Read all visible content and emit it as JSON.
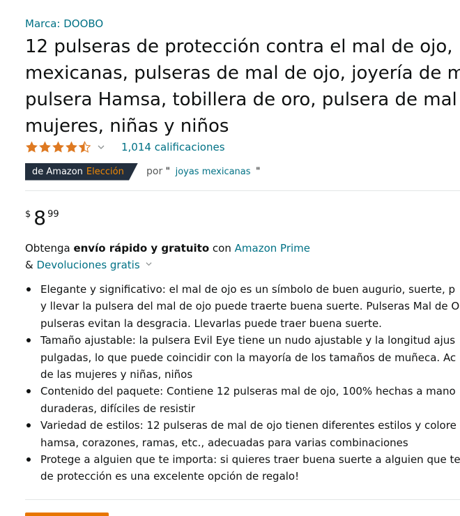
{
  "brand": {
    "text": "Marca: DOOBO"
  },
  "title": {
    "lines": [
      "12 pulseras de protección contra el mal de ojo,",
      "mexicanas, pulseras de mal de ojo, joyería de m",
      "pulsera Hamsa, tobillera de oro, pulsera de mal",
      "mujeres, niñas y niños"
    ]
  },
  "rating": {
    "stars_value": 4.5,
    "star_color": "#de7921",
    "count_text": "1,014 calificaciones"
  },
  "choice": {
    "badge_white": "de Amazon",
    "badge_orange": "Elección",
    "for_prefix": "por",
    "quote_open": "\"",
    "keyword": "joyas mexicanas",
    "quote_close": "\""
  },
  "price": {
    "symbol": "$",
    "whole": "8",
    "fraction": "99"
  },
  "shipping": {
    "prefix": "Obtenga",
    "bold": "envío rápido y gratuito",
    "middle": "con",
    "prime_link": "Amazon Prime",
    "amp": "&",
    "returns_link": "Devoluciones gratis"
  },
  "bullets": [
    {
      "lines": [
        "Elegante y significativo: el mal de ojo es un símbolo de buen augurio, suerte, p",
        "y llevar la pulsera del mal de ojo puede traerte buena suerte. Pulseras Mal de O",
        "pulseras evitan la desgracia. Llevarlas puede traer buena suerte."
      ]
    },
    {
      "lines": [
        "Tamaño ajustable: la pulsera Evil Eye tiene un nudo ajustable y la longitud ajus",
        "pulgadas, lo que puede coincidir con la mayoría de los tamaños de muñeca. Ac",
        "de las mujeres y niñas, niños"
      ]
    },
    {
      "lines": [
        "Contenido del paquete: Contiene 12 pulseras mal de ojo, 100% hechas a mano",
        "duraderas, difíciles de resistir"
      ]
    },
    {
      "lines": [
        "Variedad de estilos: 12 pulseras de mal de ojo tienen diferentes estilos y colore",
        "hamsa, corazones, ramas, etc., adecuadas para varias combinaciones"
      ]
    },
    {
      "lines": [
        "Protege a alguien que te importa: si quieres traer buena suerte a alguien que te",
        "de protección es una excelente opción de regalo!"
      ]
    }
  ]
}
